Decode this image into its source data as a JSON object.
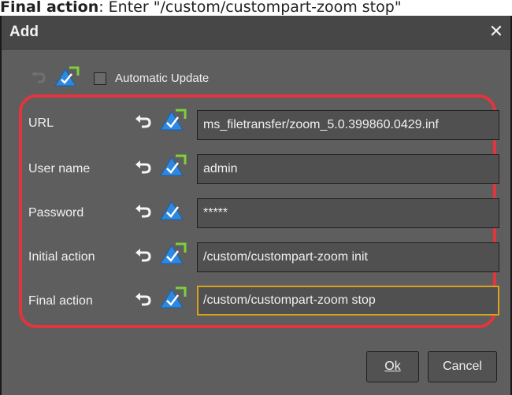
{
  "caption": {
    "label": "Final action",
    "text": ": Enter \"/custom/custompart-zoom stop\""
  },
  "dialog": {
    "title": "Add",
    "close_glyph": "✕",
    "automatic_update_label": "Automatic Update",
    "automatic_update_checked": false,
    "rows": [
      {
        "label": "URL",
        "value": "ms_filetransfer/zoom_5.0.399860.0429.inf"
      },
      {
        "label": "User name",
        "value": "admin"
      },
      {
        "label": "Password",
        "value": "*****"
      },
      {
        "label": "Initial action",
        "value": "/custom/custompart-zoom init"
      },
      {
        "label": "Final action",
        "value": "/custom/custompart-zoom stop"
      }
    ],
    "ok_label": "Ok",
    "cancel_label": "Cancel"
  },
  "colors": {
    "dialog_bg": "#5e5e5e",
    "highlight_border": "#e4343d",
    "focus_border": "#d9a21b",
    "sync_icon_blue": "#2d88e0",
    "sync_icon_green": "#7fcf3a"
  },
  "icons": [
    "revert-icon",
    "sync-icon",
    "close-icon",
    "checkbox"
  ]
}
